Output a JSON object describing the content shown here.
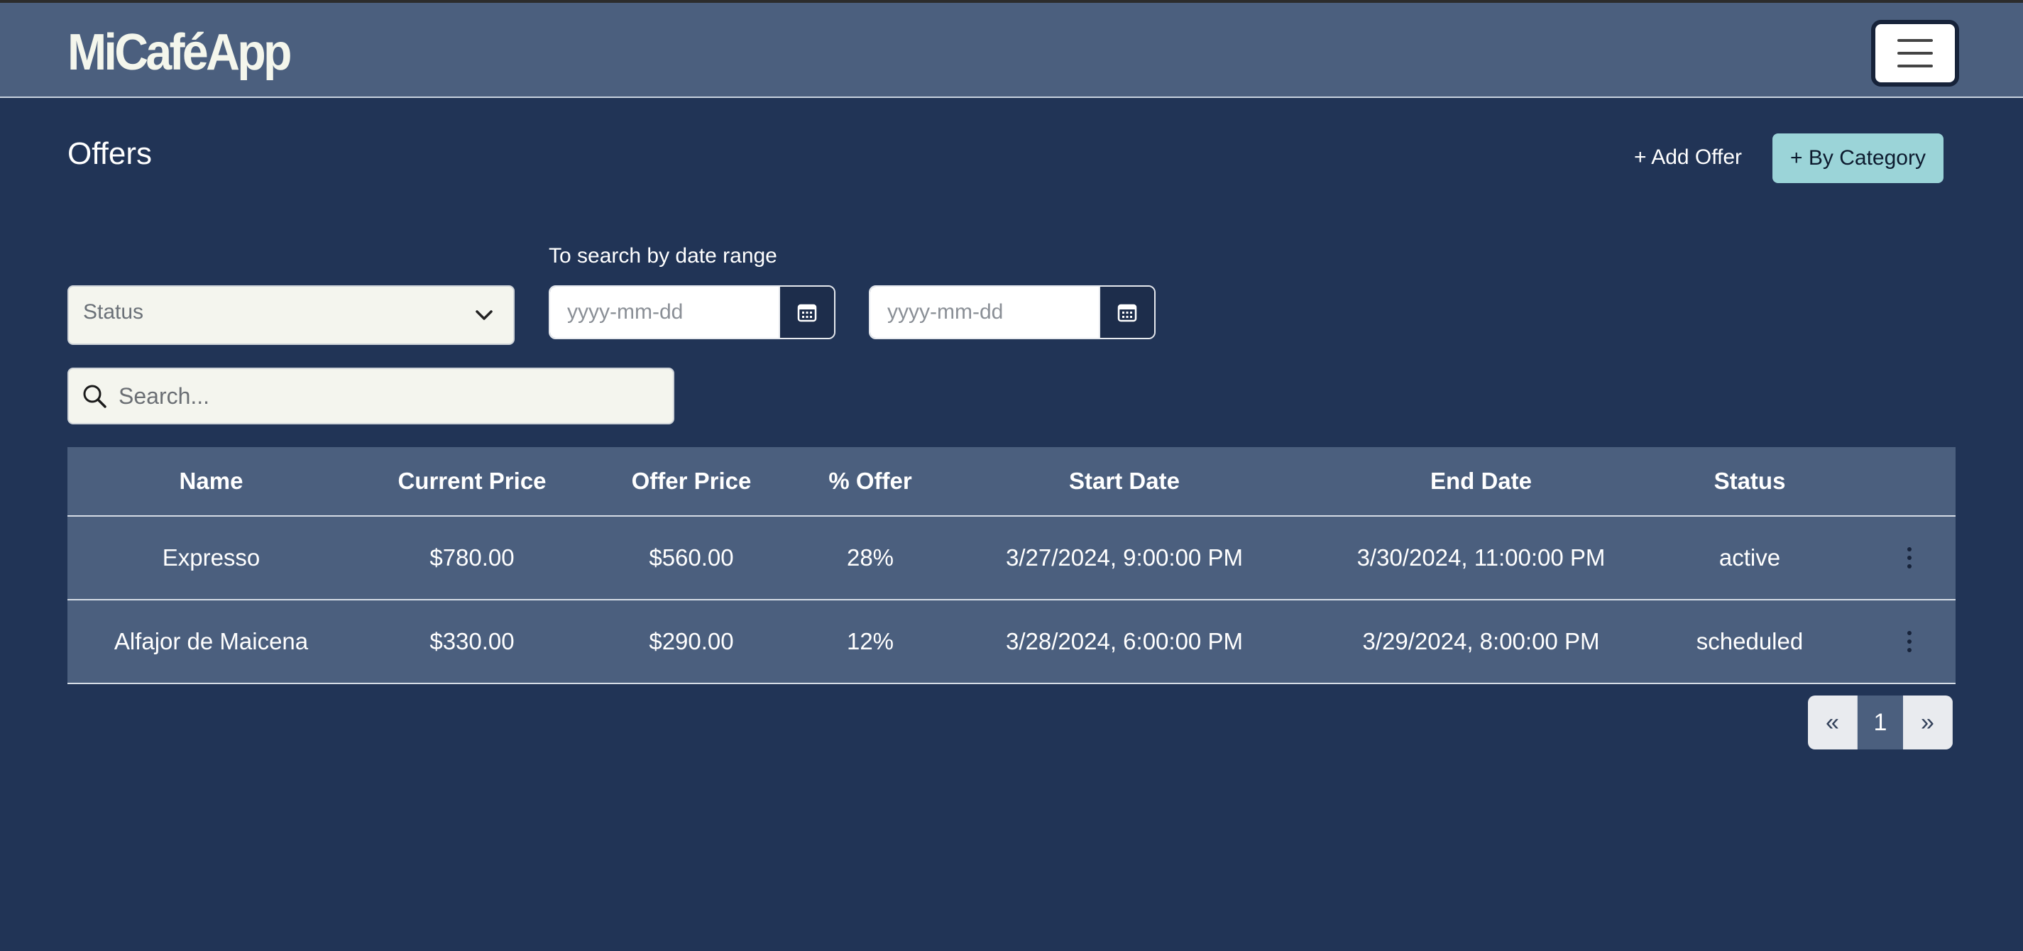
{
  "navbar": {
    "brand": "MiCaféApp"
  },
  "header": {
    "title": "Offers",
    "add_offer_label": "+ Add Offer",
    "by_category_label": "+ By Category"
  },
  "filters": {
    "status_placeholder": "Status",
    "date_hint": "To search by date range",
    "date_from_placeholder": "yyyy-mm-dd",
    "date_to_placeholder": "yyyy-mm-dd",
    "search_placeholder": "Search..."
  },
  "table": {
    "headers": {
      "name": "Name",
      "current_price": "Current Price",
      "offer_price": "Offer Price",
      "percent_offer": "% Offer",
      "start_date": "Start Date",
      "end_date": "End Date",
      "status": "Status"
    },
    "rows": [
      {
        "name": "Expresso",
        "current_price": "$780.00",
        "offer_price": "$560.00",
        "percent_offer": "28%",
        "start_date": "3/27/2024, 9:00:00 PM",
        "end_date": "3/30/2024, 11:00:00 PM",
        "status": "active"
      },
      {
        "name": "Alfajor de Maicena",
        "current_price": "$330.00",
        "offer_price": "$290.00",
        "percent_offer": "12%",
        "start_date": "3/28/2024, 6:00:00 PM",
        "end_date": "3/29/2024, 8:00:00 PM",
        "status": "scheduled"
      }
    ]
  },
  "pagination": {
    "prev": "«",
    "current": "1",
    "next": "»"
  },
  "colors": {
    "background": "#213456",
    "navbar": "#4b5f7e",
    "accent": "#9bd4d8"
  },
  "icons": {
    "menu": "hamburger-icon",
    "chevron": "chevron-down-icon",
    "calendar": "calendar-icon",
    "search": "search-icon",
    "row_actions": "kebab-menu-icon"
  }
}
